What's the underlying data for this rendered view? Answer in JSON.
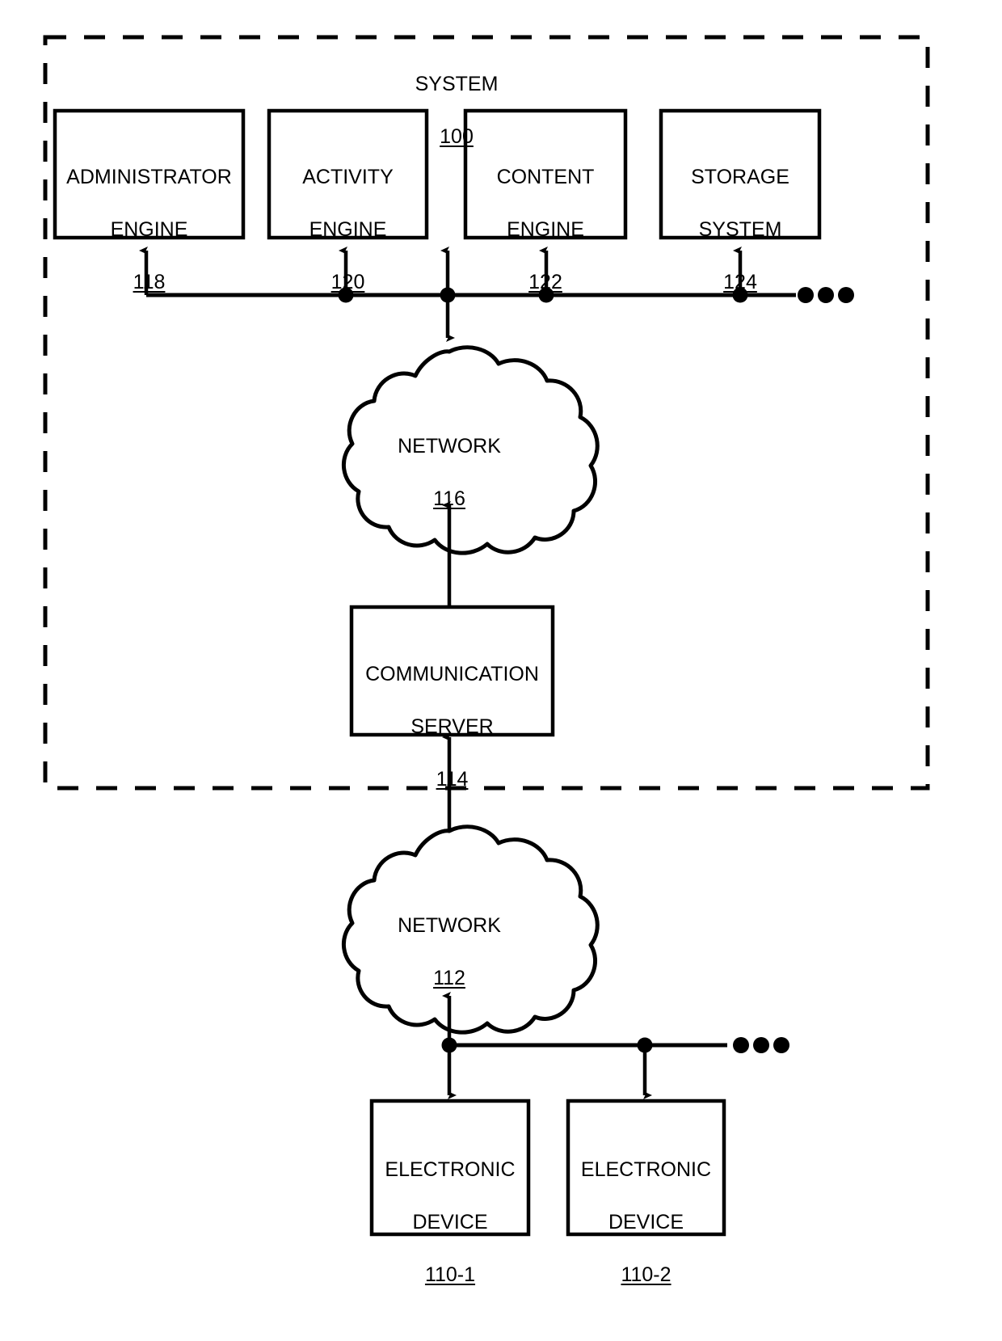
{
  "figure": {
    "type": "patent-system-block-diagram",
    "background_color": "#ffffff",
    "line_color": "#000000"
  },
  "system_boundary": {
    "label": "SYSTEM",
    "ref": "100",
    "style": "dashed"
  },
  "engines": [
    {
      "name": "engine-box-administrator",
      "line1": "ADMINISTRATOR",
      "line2": "ENGINE",
      "ref": "118"
    },
    {
      "name": "engine-box-activity",
      "line1": "ACTIVITY",
      "line2": "ENGINE",
      "ref": "120"
    },
    {
      "name": "engine-box-content",
      "line1": "CONTENT",
      "line2": "ENGINE",
      "ref": "122"
    },
    {
      "name": "engine-box-storage",
      "line1": "STORAGE",
      "line2": "SYSTEM",
      "ref": "124"
    }
  ],
  "clouds": [
    {
      "name": "network-cloud-upper",
      "label": "NETWORK",
      "ref": "116"
    },
    {
      "name": "network-cloud-lower",
      "label": "NETWORK",
      "ref": "112"
    }
  ],
  "server": {
    "line1": "COMMUNICATION",
    "line2": "SERVER",
    "ref": "114"
  },
  "devices": [
    {
      "name": "electronic-device-1",
      "line1": "ELECTRONIC",
      "line2": "DEVICE",
      "ref": "110-1"
    },
    {
      "name": "electronic-device-2",
      "line1": "ELECTRONIC",
      "line2": "DEVICE",
      "ref": "110-2"
    }
  ],
  "ellipses": [
    {
      "name": "bus-ellipsis-upper",
      "dots": 3
    },
    {
      "name": "bus-ellipsis-lower",
      "dots": 3
    }
  ]
}
